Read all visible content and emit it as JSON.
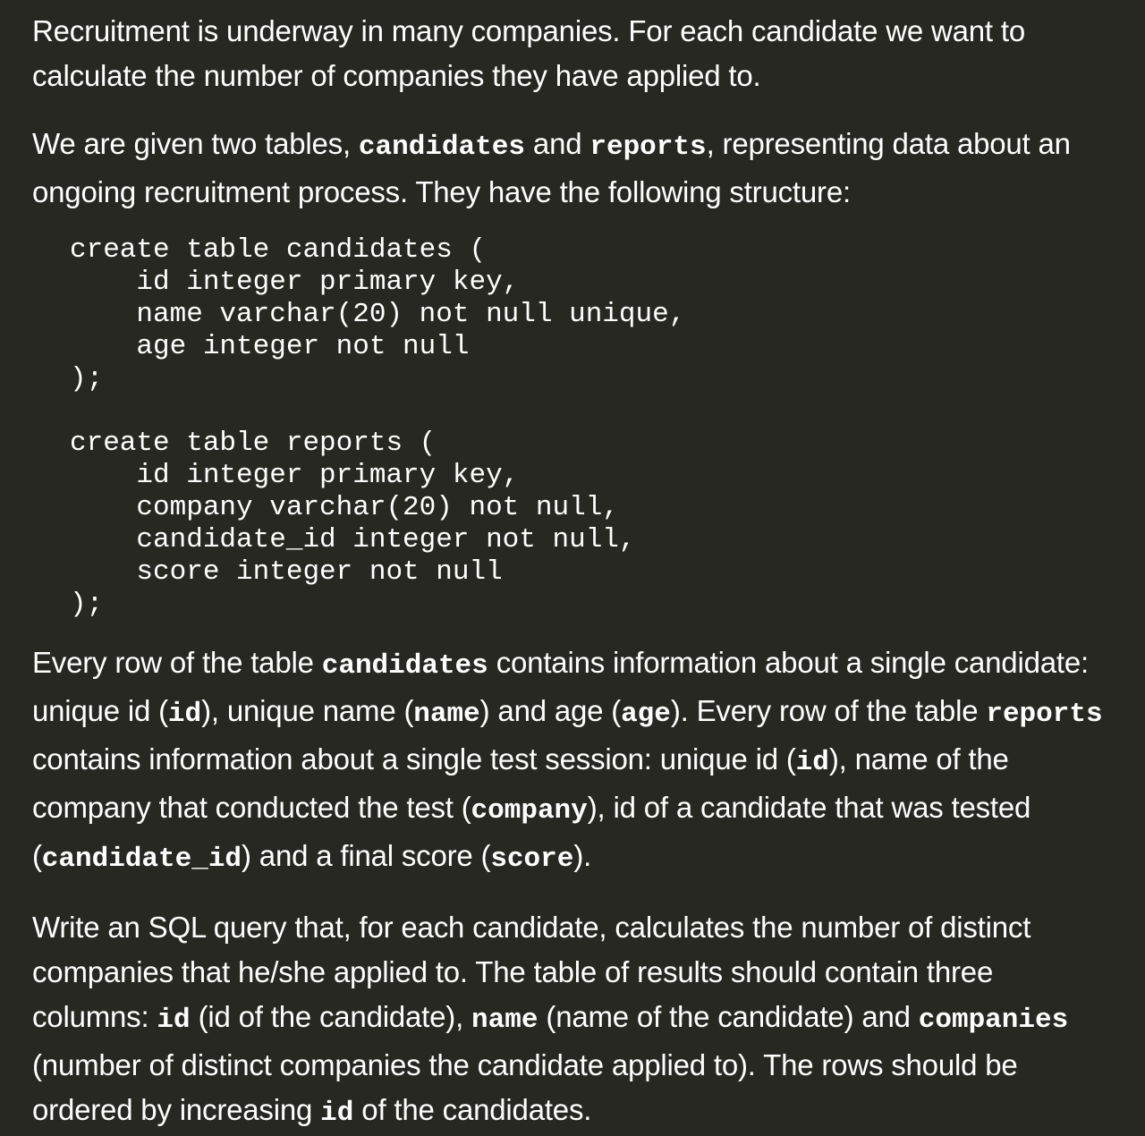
{
  "p1": {
    "t1": "Recruitment is underway in many companies. For each candidate we want to calculate the number of companies they have applied to."
  },
  "p2": {
    "t1": "We are given two tables, ",
    "c1": "candidates",
    "t2": " and ",
    "c2": "reports",
    "t3": ", representing data about an ongoing recruitment process. They have the following structure:"
  },
  "code": {
    "candidates_table": "create table candidates (\n    id integer primary key,\n    name varchar(20) not null unique,\n    age integer not null\n);",
    "reports_table": "create table reports (\n    id integer primary key,\n    company varchar(20) not null,\n    candidate_id integer not null,\n    score integer not null\n);"
  },
  "p3": {
    "t1": "Every row of the table ",
    "c1": "candidates",
    "t2": " contains information about a single candidate: unique id (",
    "c2": "id",
    "t3": "), unique name (",
    "c3": "name",
    "t4": ") and age (",
    "c4": "age",
    "t5": "). Every row of the table ",
    "c5": "reports",
    "t6": " contains information about a single test session: unique id (",
    "c6": "id",
    "t7": "), name of the company that conducted the test (",
    "c7": "company",
    "t8": "), id of a candidate that was tested (",
    "c8": "candidate_id",
    "t9": ") and a final score (",
    "c9": "score",
    "t10": ")."
  },
  "p4": {
    "t1": "Write an SQL query that, for each candidate, calculates the number of distinct companies that he/she applied to. The table of results should contain three columns: ",
    "c1": "id",
    "t2": " (id of the candidate), ",
    "c2": "name",
    "t3": " (name of the candidate) and ",
    "c3": "companies",
    "t4": " (number of distinct companies the candidate applied to). The rows should be ordered by increasing ",
    "c4": "id",
    "t5": " of the candidates."
  }
}
